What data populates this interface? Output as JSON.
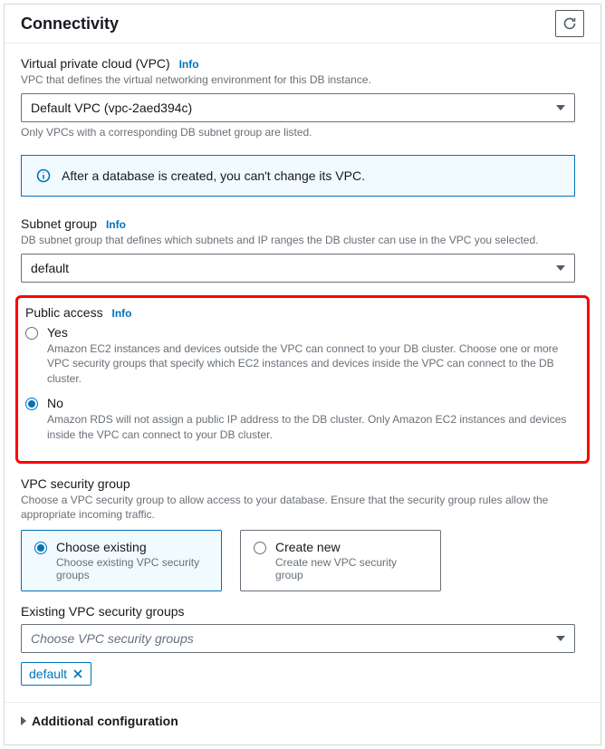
{
  "panel": {
    "title": "Connectivity"
  },
  "vpc": {
    "label": "Virtual private cloud (VPC)",
    "info": "Info",
    "desc": "VPC that defines the virtual networking environment for this DB instance.",
    "value": "Default VPC (vpc-2aed394c)",
    "hint": "Only VPCs with a corresponding DB subnet group are listed."
  },
  "callout": {
    "text": "After a database is created, you can't change its VPC."
  },
  "subnet": {
    "label": "Subnet group",
    "info": "Info",
    "desc": "DB subnet group that defines which subnets and IP ranges the DB cluster can use in the VPC you selected.",
    "value": "default"
  },
  "public_access": {
    "label": "Public access",
    "info": "Info",
    "options": [
      {
        "label": "Yes",
        "desc": "Amazon EC2 instances and devices outside the VPC can connect to your DB cluster. Choose one or more VPC security groups that specify which EC2 instances and devices inside the VPC can connect to the DB cluster.",
        "selected": false
      },
      {
        "label": "No",
        "desc": "Amazon RDS will not assign a public IP address to the DB cluster. Only Amazon EC2 instances and devices inside the VPC can connect to your DB cluster.",
        "selected": true
      }
    ]
  },
  "sg": {
    "label": "VPC security group",
    "desc": "Choose a VPC security group to allow access to your database. Ensure that the security group rules allow the appropriate incoming traffic.",
    "options": [
      {
        "title": "Choose existing",
        "desc": "Choose existing VPC security groups",
        "selected": true
      },
      {
        "title": "Create new",
        "desc": "Create new VPC security group",
        "selected": false
      }
    ]
  },
  "existing_sg": {
    "label": "Existing VPC security groups",
    "placeholder": "Choose VPC security groups",
    "tokens": [
      "default"
    ]
  },
  "additional": {
    "label": "Additional configuration"
  }
}
